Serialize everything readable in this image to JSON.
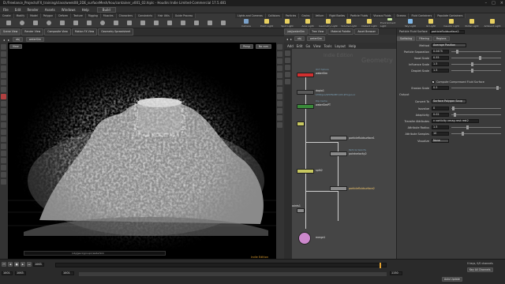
{
  "window": {
    "title": "D:/Freelance_Projects/FX_training/class/week08_2DE_surfaceMesh/hou/container_v001_02.hiplc - Houdini Indie Limited-Commercial 17.5.481"
  },
  "menu": {
    "items": [
      "File",
      "Edit",
      "Render",
      "Assets",
      "Windows",
      "Help"
    ],
    "build": "Build"
  },
  "shelf": {
    "tabs_left": [
      "Create",
      "Modify",
      "Model",
      "Polygon",
      "Deform",
      "Texture",
      "Rigging",
      "Muscles",
      "Characters",
      "Constraints",
      "Hair Utils",
      "Guide Process",
      "Guide Brushes",
      "Terrain FX",
      "Cloud FX",
      "Volume"
    ],
    "tabs_right": [
      "Lights and Cameras",
      "Collisions",
      "Particles",
      "Grains",
      "Vellum",
      "Rigid Bodies",
      "Particle Fluids",
      "Viscous Fluids",
      "Oceans",
      "Fluid Containers",
      "Populate Containers",
      "Container Tools",
      "PyroFX",
      "FEM",
      "Wires",
      "Crowds",
      "Drive Simulation"
    ],
    "tools": [
      "Camera",
      "Point Light",
      "Spot Light",
      "Area Light",
      "Geometry Light",
      "Volume Light",
      "Distant Light",
      "Environment Light",
      "Sky Light",
      "GI Light",
      "Caustic Light",
      "Portal Light",
      "Ambient Light",
      "Camera",
      "VR Camera",
      "Switcher",
      "Gamepad Camera"
    ]
  },
  "left_panel": {
    "tabs": [
      "Scene View",
      "Render View",
      "Composite View",
      "Motion FX View",
      "Geometry Spreadsheet"
    ],
    "path": [
      "obj",
      "waterSim"
    ],
    "view_label": "View",
    "persp": "Persp",
    "cam": "No cam",
    "status_path": "/obj/geo1/group1/waterSim",
    "watermark": "Indie Edition"
  },
  "network_panel": {
    "tabs": [
      "/obj/waterSim",
      "Tree View",
      "Material Palette",
      "Asset Browser"
    ],
    "path": [
      "obj",
      "waterSim"
    ],
    "menu": [
      "Add",
      "Edit",
      "Go",
      "View",
      "Tools",
      "Layout",
      "Help"
    ],
    "watermark1": "Indie Edition",
    "watermark2": "Geometry",
    "nodes": [
      {
        "name": "waterSim",
        "sub": "OUT Sphere",
        "color": "#d03030"
      },
      {
        "name": "dopio1",
        "sub": "$HIP/geo/$HIPNAME.$OS.$F.bgeo.sc",
        "color": "#5a5a5a"
      },
      {
        "name": "waterSimPT",
        "sub": "Pop Cache",
        "color": "#3a8a3a"
      },
      {
        "name": "null1",
        "sub": "",
        "color": "#c8c860"
      },
      {
        "name": "particlefluidsurface1",
        "sub": "",
        "color": "#8a8a8a"
      },
      {
        "name": "pointvelocity2",
        "sub": "Particle Velocity",
        "color": "#8a8a8a"
      },
      {
        "name": "split2",
        "sub": "",
        "color": "#c8c860"
      },
      {
        "name": "particlefluidsurface2",
        "sub": "",
        "color": "#8a8a8a"
      },
      {
        "name": "pyropoints1",
        "sub": "",
        "color": "#8a8a8a"
      },
      {
        "name": "merge1",
        "sub": "",
        "color": "#cc88cc"
      }
    ]
  },
  "param_panel": {
    "node_type": "Particle Fluid Surface",
    "node_name": "particlefluidsurface2",
    "tabs": [
      "Surfacing",
      "Filtering",
      "Regions"
    ],
    "params": [
      {
        "label": "Method",
        "value": "Average Position"
      },
      {
        "label": "Particle Separation",
        "value": "0.0475"
      },
      {
        "label": "Voxel Scale",
        "value": "0.55"
      },
      {
        "label": "Influence Scale",
        "value": "1.5"
      },
      {
        "label": "Droplet Scale",
        "value": "1.5"
      }
    ],
    "check_label": "Compute Compressed Fluid Surface",
    "erosion": {
      "label": "Erosion Scale",
      "value": "0.5"
    },
    "output_label": "Output",
    "convert_to": {
      "label": "Convert To",
      "value": "Surface Polygon Soup"
    },
    "adaptivity": [
      {
        "label": "Isovalue",
        "value": "0"
      },
      {
        "label": "Adaptivity",
        "value": "0.02"
      }
    ],
    "transfer": {
      "label": "Transfer Attributes",
      "value": "v vorticity vmag rest rest2"
    },
    "attr_radius": {
      "label": "Attribute Radius",
      "value": "1.5"
    },
    "attr_samples": {
      "label": "Attribute Samples",
      "value": "10"
    },
    "visualize": {
      "label": "Visualize",
      "value": "None"
    }
  },
  "timeline": {
    "frame": "1063",
    "start": "1001",
    "end": "1063",
    "range_start": "1001",
    "range_end": "1150",
    "keys_label": "0 keys, 0/0 channels",
    "key_all": "Key All Channels",
    "autoupdate": "Auto Update"
  },
  "colors": {
    "bg": "#2b2b2b",
    "viewport": "#000000",
    "accent": "#e0a030"
  }
}
